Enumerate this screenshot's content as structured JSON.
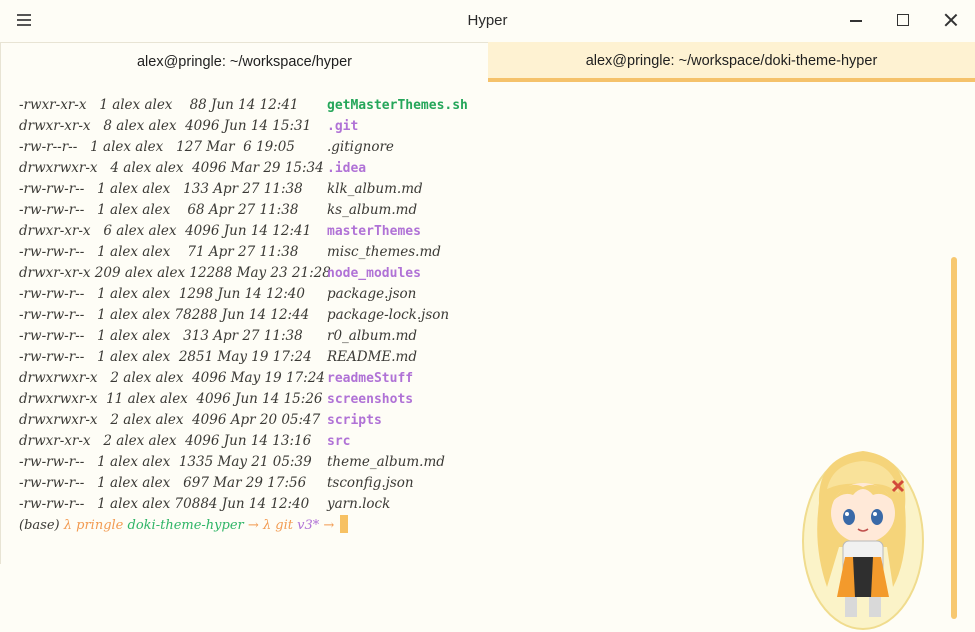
{
  "window": {
    "title": "Hyper"
  },
  "tabs": [
    {
      "label": "alex@pringle: ~/workspace/hyper",
      "active": false
    },
    {
      "label": "alex@pringle: ~/workspace/doki-theme-hyper",
      "active": true
    }
  ],
  "listing": [
    {
      "meta": "-rwxr-xr-x   1 alex alex    88 Jun 14 12:41",
      "name": "getMasterThemes.sh",
      "kind": "exec"
    },
    {
      "meta": "drwxr-xr-x   8 alex alex  4096 Jun 14 15:31",
      "name": ".git",
      "kind": "dir"
    },
    {
      "meta": "-rw-r--r--   1 alex alex   127 Mar  6 19:05",
      "name": ".gitignore",
      "kind": "file"
    },
    {
      "meta": "drwxrwxr-x   4 alex alex  4096 Mar 29 15:34",
      "name": ".idea",
      "kind": "dir"
    },
    {
      "meta": "-rw-rw-r--   1 alex alex   133 Apr 27 11:38",
      "name": "klk_album.md",
      "kind": "file"
    },
    {
      "meta": "-rw-rw-r--   1 alex alex    68 Apr 27 11:38",
      "name": "ks_album.md",
      "kind": "file"
    },
    {
      "meta": "drwxr-xr-x   6 alex alex  4096 Jun 14 12:41",
      "name": "masterThemes",
      "kind": "dir"
    },
    {
      "meta": "-rw-rw-r--   1 alex alex    71 Apr 27 11:38",
      "name": "misc_themes.md",
      "kind": "file"
    },
    {
      "meta": "drwxr-xr-x 209 alex alex 12288 May 23 21:28",
      "name": "node_modules",
      "kind": "dir"
    },
    {
      "meta": "-rw-rw-r--   1 alex alex  1298 Jun 14 12:40",
      "name": "package.json",
      "kind": "file"
    },
    {
      "meta": "-rw-rw-r--   1 alex alex 78288 Jun 14 12:44",
      "name": "package-lock.json",
      "kind": "file"
    },
    {
      "meta": "-rw-rw-r--   1 alex alex   313 Apr 27 11:38",
      "name": "r0_album.md",
      "kind": "file"
    },
    {
      "meta": "-rw-rw-r--   1 alex alex  2851 May 19 17:24",
      "name": "README.md",
      "kind": "file"
    },
    {
      "meta": "drwxrwxr-x   2 alex alex  4096 May 19 17:24",
      "name": "readmeStuff",
      "kind": "dir"
    },
    {
      "meta": "drwxrwxr-x  11 alex alex  4096 Jun 14 15:26",
      "name": "screenshots",
      "kind": "dir"
    },
    {
      "meta": "drwxrwxr-x   2 alex alex  4096 Apr 20 05:47",
      "name": "scripts",
      "kind": "dir"
    },
    {
      "meta": "drwxr-xr-x   2 alex alex  4096 Jun 14 13:16",
      "name": "src",
      "kind": "dir"
    },
    {
      "meta": "-rw-rw-r--   1 alex alex  1335 May 21 05:39",
      "name": "theme_album.md",
      "kind": "file"
    },
    {
      "meta": "-rw-rw-r--   1 alex alex   697 Mar 29 17:56",
      "name": "tsconfig.json",
      "kind": "file"
    },
    {
      "meta": "-rw-rw-r--   1 alex alex 70884 Jun 14 12:40",
      "name": "yarn.lock",
      "kind": "file"
    }
  ],
  "prompt": {
    "env": "(base)",
    "lambda": "λ",
    "host": "pringle",
    "dir": "doki-theme-hyper",
    "arrow": "→",
    "git_lambda": "λ git",
    "branch": "v3*",
    "arrow2": "→"
  },
  "colors": {
    "background": "#fefdf6",
    "accent": "#f5c26b",
    "directory": "#b072d6",
    "executable": "#25a65a",
    "prompt_orange": "#f29b52"
  },
  "icons": {
    "menu": "hamburger-menu-icon",
    "minimize": "minimize-icon",
    "maximize": "maximize-icon",
    "close": "close-icon"
  }
}
